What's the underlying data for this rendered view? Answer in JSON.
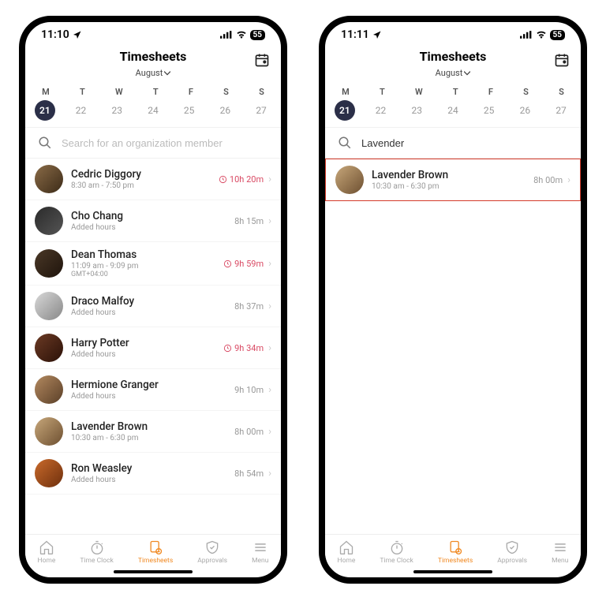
{
  "status": {
    "time_a": "11:10",
    "time_b": "11:11",
    "battery": "55"
  },
  "header": {
    "title": "Timesheets",
    "month": "August"
  },
  "week": [
    "M",
    "T",
    "W",
    "T",
    "F",
    "S",
    "S"
  ],
  "dates": [
    "21",
    "22",
    "23",
    "24",
    "25",
    "26",
    "27"
  ],
  "search": {
    "placeholder": "Search for an organization member",
    "value_b": "Lavender"
  },
  "members": [
    {
      "name": "Cedric Diggory",
      "sub": "8:30 am - 7:50 pm",
      "hours": "10h 20m",
      "warn": true
    },
    {
      "name": "Cho Chang",
      "sub": "Added hours",
      "hours": "8h 15m",
      "warn": false
    },
    {
      "name": "Dean Thomas",
      "sub": "11:09 am - 9:09 pm",
      "sub2": "GMT+04:00",
      "hours": "9h 59m",
      "warn": true
    },
    {
      "name": "Draco Malfoy",
      "sub": "Added hours",
      "hours": "8h 37m",
      "warn": false
    },
    {
      "name": "Harry Potter",
      "sub": "Added hours",
      "hours": "9h 34m",
      "warn": true
    },
    {
      "name": "Hermione Granger",
      "sub": "Added hours",
      "hours": "9h 10m",
      "warn": false
    },
    {
      "name": "Lavender Brown",
      "sub": "10:30 am - 6:30 pm",
      "hours": "8h 00m",
      "warn": false
    },
    {
      "name": "Ron Weasley",
      "sub": "Added hours",
      "hours": "8h 54m",
      "warn": false
    }
  ],
  "result_b": {
    "name": "Lavender Brown",
    "sub": "10:30 am - 6:30 pm",
    "hours": "8h 00m"
  },
  "tabs": {
    "home": "Home",
    "timeclock": "Time Clock",
    "timesheets": "Timesheets",
    "approvals": "Approvals",
    "menu": "Menu"
  }
}
